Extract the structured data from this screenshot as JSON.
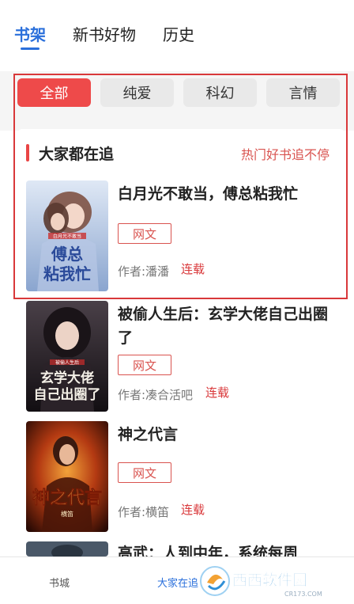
{
  "top_tabs": [
    {
      "label": "书架",
      "active": true
    },
    {
      "label": "新书好物",
      "active": false
    },
    {
      "label": "历史",
      "active": false
    }
  ],
  "filters": [
    {
      "label": "全部",
      "active": true
    },
    {
      "label": "纯爱",
      "active": false
    },
    {
      "label": "科幻",
      "active": false
    },
    {
      "label": "言情",
      "active": false
    }
  ],
  "section": {
    "title": "大家都在追",
    "link": "热门好书追不停"
  },
  "books": [
    {
      "title": "白月光不敢当，傅总粘我忙",
      "tag": "网文",
      "author": "作者:潘潘",
      "status": "连载",
      "cover_text": "傅总粘我忙",
      "cover_small": "白月光不敢当",
      "cover_colors": [
        "#c9d9ee",
        "#9fb6d8"
      ]
    },
    {
      "title": "被偷人生后：玄学大佬自己出圈了",
      "tag": "网文",
      "author": "作者:凑合活吧",
      "status": "连载",
      "cover_text": "玄学大佬自己出圈了",
      "cover_small": "被偷人生后",
      "cover_colors": [
        "#3a3035",
        "#141014"
      ]
    },
    {
      "title": "神之代言",
      "tag": "网文",
      "author": "作者:横笛",
      "status": "连载",
      "cover_text": "神之代言",
      "cover_small": "横笛",
      "cover_colors": [
        "#b43a12",
        "#3a0e05"
      ]
    },
    {
      "title": "高武：人到中年，系统每周",
      "cover_colors": [
        "#5a6a7a",
        "#2a3440"
      ]
    }
  ],
  "bottom_nav": [
    {
      "label": "书城",
      "active": false
    },
    {
      "label": "大家在追",
      "active": true
    }
  ],
  "watermark": {
    "brand": "西西软件园",
    "domain": "CR173.COM"
  },
  "colors": {
    "accent_blue": "#2a6fdb",
    "accent_red": "#ee4a4a",
    "status_red": "#d9383a"
  }
}
